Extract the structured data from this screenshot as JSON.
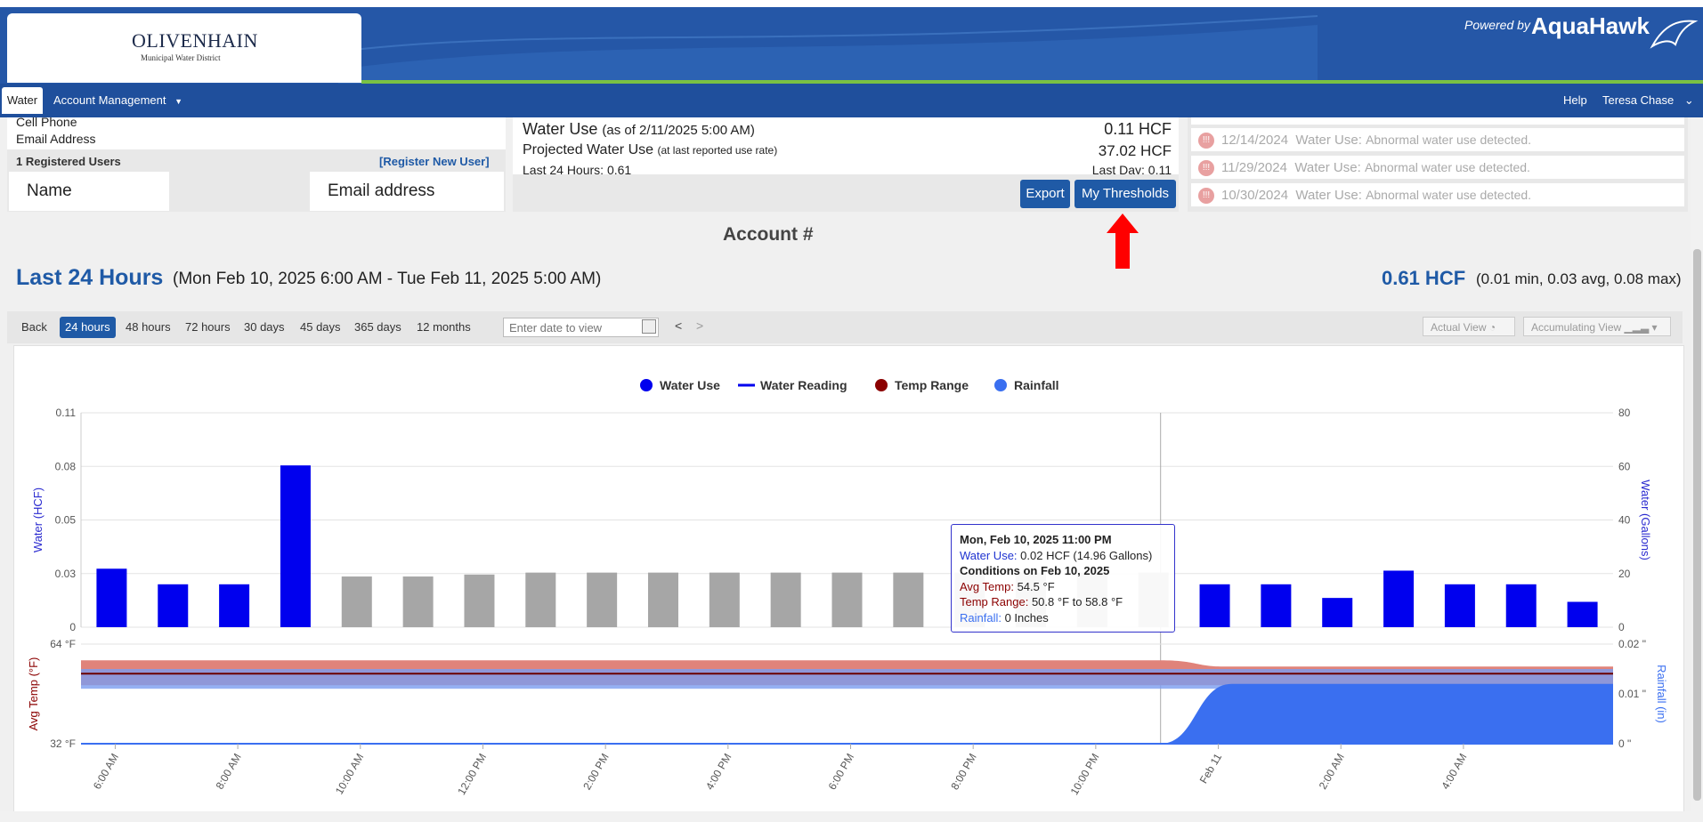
{
  "header": {
    "logo_title": "OLIVENHAIN",
    "logo_subtitle": "Municipal Water District",
    "powered_by": "Powered by",
    "brand": "AquaHawk"
  },
  "nav": {
    "water_tab": "Water",
    "account_menu": "Account Management",
    "help": "Help",
    "user": "Teresa Chase"
  },
  "account_panel": {
    "cell_phone": "Cell Phone",
    "email_address": "Email Address",
    "registered_users": "1 Registered Users",
    "register_link": "[Register New User]",
    "col_name": "Name",
    "col_email": "Email address"
  },
  "water_panel": {
    "water_use_label": "Water Use",
    "water_use_asof": "(as of 2/11/2025 5:00 AM)",
    "water_use_value": "0.11 HCF",
    "projected_label": "Projected Water Use",
    "projected_note": "(at last reported use rate)",
    "projected_value": "37.02 HCF",
    "last24": "Last 24 Hours: 0.61",
    "last_day": "Last Day: 0.11",
    "export_btn": "Export",
    "thresholds_btn": "My Thresholds"
  },
  "alerts": [
    {
      "date": "12/14/2024",
      "text": "Water Use:",
      "detail": "Abnormal water use detected."
    },
    {
      "date": "11/29/2024",
      "text": "Water Use:",
      "detail": "Abnormal water use detected."
    },
    {
      "date": "10/30/2024",
      "text": "Water Use:",
      "detail": "Abnormal water use detected."
    }
  ],
  "account_heading": "Account #",
  "summary": {
    "title": "Last 24 Hours",
    "range": "(Mon Feb 10, 2025 6:00 AM - Tue Feb 11, 2025 5:00 AM)",
    "total": "0.61 HCF",
    "stats": "(0.01 min, 0.03 avg, 0.08 max)"
  },
  "toolbar": {
    "back": "Back",
    "ranges": [
      "24 hours",
      "48 hours",
      "72 hours",
      "30 days",
      "45 days",
      "365 days",
      "12 months"
    ],
    "date_placeholder": "Enter date to view",
    "prev": "<",
    "next": ">",
    "actual_view": "Actual View",
    "accumulating_view": "Accumulating View"
  },
  "tooltip": {
    "title": "Mon, Feb 10, 2025 11:00 PM",
    "water_use_label": "Water Use:",
    "water_use_value": "0.02 HCF (14.96 Gallons)",
    "conditions": "Conditions on Feb 10, 2025",
    "avg_temp_label": "Avg Temp:",
    "avg_temp_value": "54.5 °F",
    "temp_range_label": "Temp Range:",
    "temp_range_value": "50.8 °F to 58.8 °F",
    "rainfall_label": "Rainfall:",
    "rainfall_value": "0 Inches"
  },
  "colors": {
    "brand_blue": "#1f5aa6",
    "water_bar": "#0000ee",
    "gray_bar": "#a6a6a6",
    "temp": "#8b0000",
    "rain": "#3a6ff0"
  },
  "chart_data": [
    {
      "type": "bar",
      "legend": [
        "Water Use",
        "Water Reading",
        "Temp Range",
        "Rainfall"
      ],
      "ylabel": "Water (HCF)",
      "y2label": "Water (Gallons)",
      "yticks": [
        "0",
        "0.03",
        "0.05",
        "0.08",
        "0.11"
      ],
      "y2ticks": [
        "0",
        "20",
        "40",
        "60",
        "80"
      ],
      "ylim": [
        0,
        0.11
      ],
      "values": [
        0.03,
        0.022,
        0.022,
        0.083,
        0.026,
        0.026,
        0.027,
        0.028,
        0.028,
        0.028,
        0.028,
        0.028,
        0.028,
        0.028,
        0.028,
        0.028,
        0.028,
        0.028,
        0.022,
        0.022,
        0.015,
        0.029,
        0.022,
        0.022,
        0.013
      ],
      "highlighted": [
        true,
        true,
        true,
        true,
        false,
        false,
        false,
        false,
        false,
        false,
        false,
        false,
        false,
        false,
        false,
        false,
        false,
        false,
        true,
        true,
        true,
        true,
        true,
        true,
        true
      ],
      "grid": true
    },
    {
      "type": "area",
      "ylabel": "Avg Temp (°F)",
      "y2label": "Rainfall (in)",
      "yticks": [
        "32 °F",
        "64 °F"
      ],
      "y2ticks": [
        "0 \"",
        "0.01 \"",
        "0.02 \""
      ],
      "xticks": [
        "6:00 AM",
        "8:00 AM",
        "10:00 AM",
        "12:00 PM",
        "2:00 PM",
        "4:00 PM",
        "6:00 PM",
        "8:00 PM",
        "10:00 PM",
        "Feb 11",
        "2:00 AM",
        "4:00 AM"
      ],
      "series": [
        {
          "name": "Temp Range",
          "values_low": [
            50.8,
            50.8
          ],
          "values_high": [
            58.8,
            56.8
          ]
        },
        {
          "name": "Rainfall",
          "values": [
            0,
            0.012
          ]
        }
      ]
    }
  ]
}
